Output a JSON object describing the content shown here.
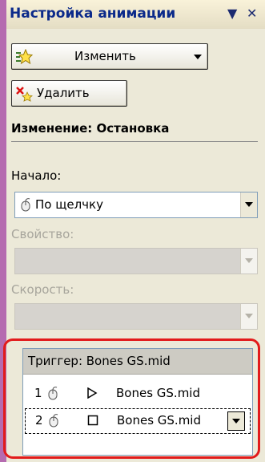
{
  "panel": {
    "title": "Настройка анимации",
    "title_menu_glyph": "▼",
    "close_glyph": "✕"
  },
  "buttons": {
    "change_label": "Изменить",
    "delete_label": "Удалить"
  },
  "section": {
    "heading": "Изменение: Остановка"
  },
  "fields": {
    "start_label": "Начало:",
    "start_value": "По щелчку",
    "property_label": "Свойство:",
    "speed_label": "Скорость:"
  },
  "list": {
    "trigger_label": "Триггер: Bones GS.mid",
    "items": [
      {
        "num": "1",
        "name": "Bones GS.mid",
        "effect_icon": "play-icon"
      },
      {
        "num": "2",
        "name": "Bones GS.mid",
        "effect_icon": "stop-icon"
      }
    ]
  },
  "colors": {
    "title_text": "#0b2a8a",
    "highlight_ring": "#e21b1b",
    "background": "#c77bc0"
  }
}
